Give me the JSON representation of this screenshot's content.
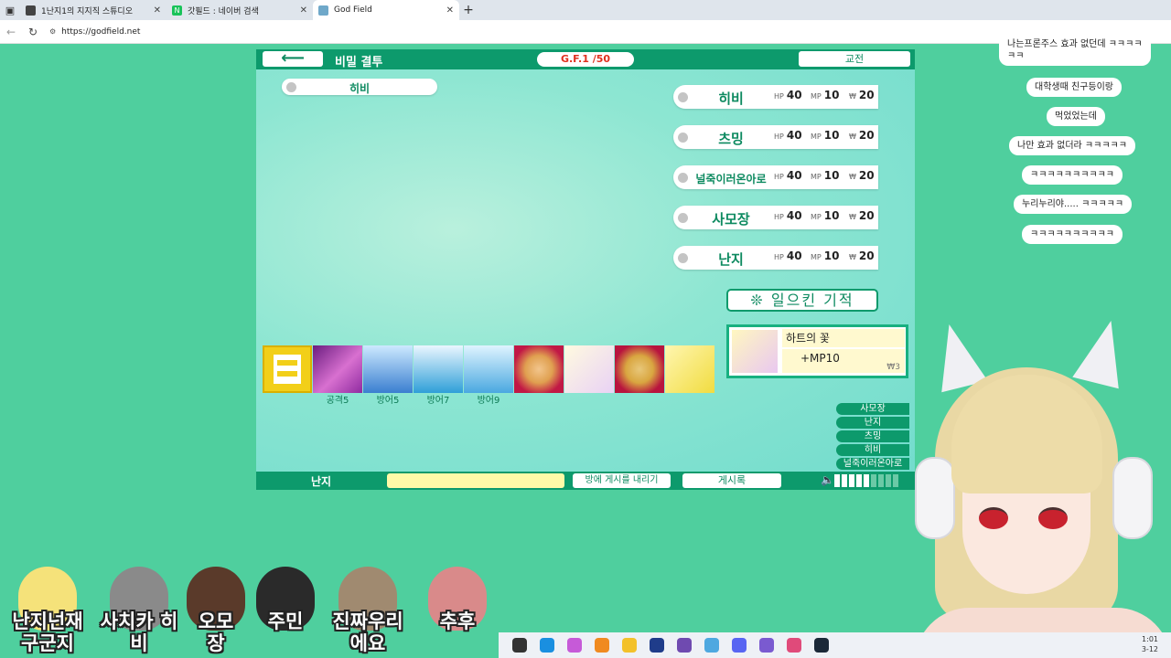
{
  "browser": {
    "tabs": [
      {
        "title": "1난지1의 지지직 스튜디오",
        "active": false
      },
      {
        "title": "갓필드 : 네이버 검색",
        "active": false
      },
      {
        "title": "God Field",
        "active": true
      }
    ],
    "url": "https://godfield.net"
  },
  "game": {
    "title": "비밀 결투",
    "gf_badge": "G.F.1 /50",
    "exchange_label": "교전",
    "self_name": "히비",
    "players": [
      {
        "name": "히비",
        "hp": "40",
        "mp": "10",
        "money": "20"
      },
      {
        "name": "츠밍",
        "hp": "40",
        "mp": "10",
        "money": "20"
      },
      {
        "name": "널죽이러온아로",
        "hp": "40",
        "mp": "10",
        "money": "20"
      },
      {
        "name": "사모장",
        "hp": "40",
        "mp": "10",
        "money": "20"
      },
      {
        "name": "난지",
        "hp": "40",
        "mp": "10",
        "money": "20"
      }
    ],
    "stat_labels": {
      "hp": "HP",
      "mp": "MP",
      "money": "₩"
    },
    "miracle_label": "❊ 일으킨 기적",
    "selected_card": {
      "name": "하트의 꽃",
      "effect": "+MP10",
      "cost": "₩3"
    },
    "hand": [
      {
        "kind": "deck",
        "label": ""
      },
      {
        "kind": "c-trident",
        "label": "공격5"
      },
      {
        "kind": "c-armor1",
        "label": "방어5"
      },
      {
        "kind": "c-armor2",
        "label": "방어7"
      },
      {
        "kind": "c-armor3",
        "label": "방어9"
      },
      {
        "kind": "c-red1",
        "label": ""
      },
      {
        "kind": "c-flower",
        "label": ""
      },
      {
        "kind": "c-red2",
        "label": ""
      },
      {
        "kind": "c-gold",
        "label": ""
      }
    ],
    "turn_order": [
      "사모장",
      "난지",
      "츠밍",
      "히비",
      "널죽이러온아로"
    ],
    "bottom": {
      "turn_name": "난지",
      "post_label": "방에 게시를 내리기",
      "board_label": "게시록"
    },
    "volume_level": 0.5
  },
  "chat_bubbles": [
    "나는프론주스 효과 없던데 ㅋㅋㅋㅋ\nㅋㅋ",
    "대학생때 친구등이랑",
    "먹었었는데",
    "나만 효과 없더라 ㅋㅋㅋㅋㅋ",
    "ㅋㅋㅋㅋㅋㅋㅋㅋㅋㅋ",
    "누리누리야..... ㅋㅋㅋㅋㅋ",
    "ㅋㅋㅋㅋㅋㅋㅋㅋㅋㅋ"
  ],
  "avatars": [
    {
      "label": "난지넌재\n구군지",
      "color": "#f5e27a"
    },
    {
      "label": "사치카 히\n비",
      "color": "#8a8a8a"
    },
    {
      "label": "오모\n장",
      "color": "#5a3a2a"
    },
    {
      "label": "주민",
      "color": "#2a2a2a"
    },
    {
      "label": "진짜우리\n에요",
      "color": "#a08a70"
    },
    {
      "label": "추후",
      "color": "#d98a8a"
    }
  ],
  "clock": {
    "time": "1:01",
    "date": "3-12"
  },
  "colors": {
    "brand_green": "#0d9a6c",
    "bg_green": "#4fcf9e",
    "money_red": "#e0301e"
  }
}
